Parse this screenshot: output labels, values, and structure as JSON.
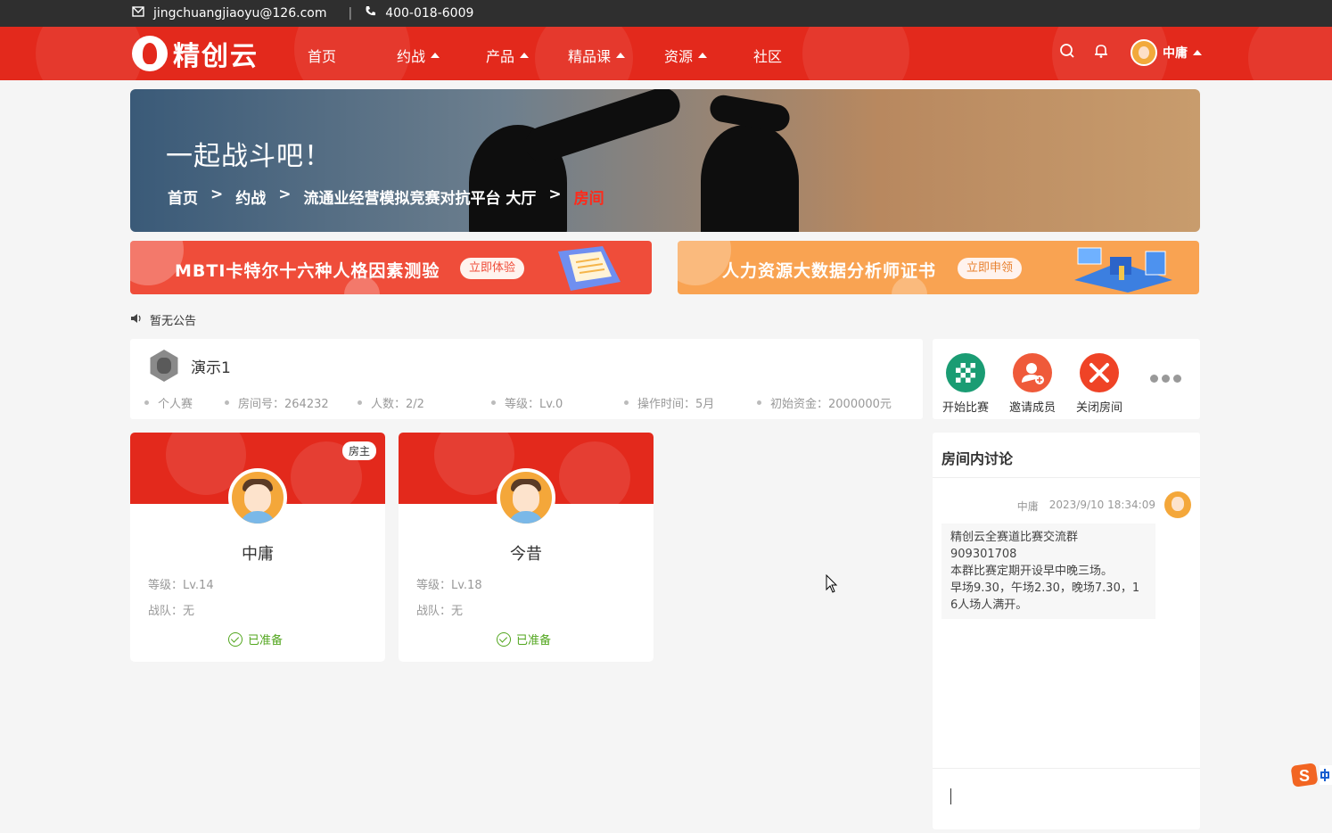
{
  "topbar": {
    "email": "jingchuangjiaoyu@126.com",
    "phone": "400-018-6009"
  },
  "nav": {
    "logo": "精创云",
    "items": [
      {
        "label": "首页",
        "dropdown": false
      },
      {
        "label": "约战",
        "dropdown": true
      },
      {
        "label": "产品",
        "dropdown": true
      },
      {
        "label": "精品课",
        "dropdown": true
      },
      {
        "label": "资源",
        "dropdown": true
      },
      {
        "label": "社区",
        "dropdown": false
      }
    ],
    "user": "中庸"
  },
  "banner": {
    "title": "一起战斗吧！",
    "breadcrumb": [
      "首页",
      "约战",
      "流通业经营模拟竞赛对抗平台 大厅",
      "房间"
    ],
    "separator": ">"
  },
  "promos": [
    {
      "text": "MBTI卡特尔十六种人格因素测验",
      "button": "立即体验",
      "color": "#ef4d3a"
    },
    {
      "text": "人力资源大数据分析师证书",
      "button": "立即申领",
      "color": "#f9a352"
    }
  ],
  "notice": "暂无公告",
  "room": {
    "name": "演示1",
    "meta": [
      "个人赛",
      "房间号：264232",
      "人数：2/2",
      "等级：Lv.0",
      "操作时间：5月",
      "初始资金：2000000元"
    ]
  },
  "actions": [
    {
      "label": "开始比赛",
      "icon": "checkered-flag-icon",
      "color": "#1a9c73"
    },
    {
      "label": "邀请成员",
      "icon": "add-user-icon",
      "color": "#ef5a3a"
    },
    {
      "label": "关闭房间",
      "icon": "close-icon",
      "color": "#ef4326"
    }
  ],
  "players": [
    {
      "name": "中庸",
      "level": "等级：Lv.14",
      "team": "战队：无",
      "status": "已准备",
      "badge": "房主"
    },
    {
      "name": "今昔",
      "level": "等级：Lv.18",
      "team": "战队：无",
      "status": "已准备",
      "badge": ""
    }
  ],
  "chat": {
    "title": "房间内讨论",
    "messages": [
      {
        "user": "中庸",
        "time": "2023/9/10 18:34:09",
        "text": "精创云全赛道比赛交流群\n909301708\n本群比赛定期开设早中晚三场。\n早场9.30，午场2.30，晚场7.30，16人场人满开。"
      }
    ]
  }
}
